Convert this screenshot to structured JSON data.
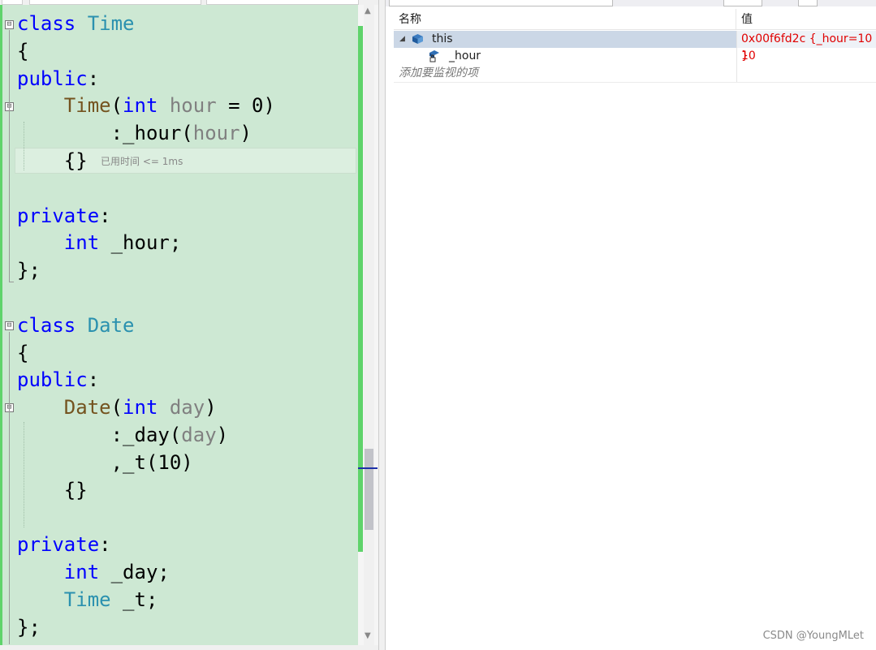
{
  "editor": {
    "lines": [
      [
        {
          "t": "class",
          "k": "kw"
        },
        {
          "t": " ",
          "k": "tx"
        },
        {
          "t": "Time",
          "k": "ty"
        }
      ],
      [
        {
          "t": "{",
          "k": "tx"
        }
      ],
      [
        {
          "t": "public",
          "k": "kw"
        },
        {
          "t": ":",
          "k": "tx"
        }
      ],
      [
        {
          "t": "    ",
          "k": "tx"
        },
        {
          "t": "Time",
          "k": "fn"
        },
        {
          "t": "(",
          "k": "tx"
        },
        {
          "t": "int",
          "k": "kw"
        },
        {
          "t": " ",
          "k": "tx"
        },
        {
          "t": "hour",
          "k": "pm"
        },
        {
          "t": " = 0)",
          "k": "tx"
        }
      ],
      [
        {
          "t": "        :_hour(",
          "k": "tx"
        },
        {
          "t": "hour",
          "k": "pm"
        },
        {
          "t": ")",
          "k": "tx"
        }
      ],
      [
        {
          "t": "    {}",
          "k": "tx"
        }
      ],
      [],
      [
        {
          "t": "private",
          "k": "kw"
        },
        {
          "t": ":",
          "k": "tx"
        }
      ],
      [
        {
          "t": "    ",
          "k": "tx"
        },
        {
          "t": "int",
          "k": "kw"
        },
        {
          "t": " _hour;",
          "k": "tx"
        }
      ],
      [
        {
          "t": "};",
          "k": "tx"
        }
      ],
      [],
      [
        {
          "t": "class",
          "k": "kw"
        },
        {
          "t": " ",
          "k": "tx"
        },
        {
          "t": "Date",
          "k": "ty"
        }
      ],
      [
        {
          "t": "{",
          "k": "tx"
        }
      ],
      [
        {
          "t": "public",
          "k": "kw"
        },
        {
          "t": ":",
          "k": "tx"
        }
      ],
      [
        {
          "t": "    ",
          "k": "tx"
        },
        {
          "t": "Date",
          "k": "fn"
        },
        {
          "t": "(",
          "k": "tx"
        },
        {
          "t": "int",
          "k": "kw"
        },
        {
          "t": " ",
          "k": "tx"
        },
        {
          "t": "day",
          "k": "pm"
        },
        {
          "t": ")",
          "k": "tx"
        }
      ],
      [
        {
          "t": "        :_day(",
          "k": "tx"
        },
        {
          "t": "day",
          "k": "pm"
        },
        {
          "t": ")",
          "k": "tx"
        }
      ],
      [
        {
          "t": "        ,_t(10)",
          "k": "tx"
        }
      ],
      [
        {
          "t": "    {}",
          "k": "tx"
        }
      ],
      [],
      [
        {
          "t": "private",
          "k": "kw"
        },
        {
          "t": ":",
          "k": "tx"
        }
      ],
      [
        {
          "t": "    ",
          "k": "tx"
        },
        {
          "t": "int",
          "k": "kw"
        },
        {
          "t": " _day;",
          "k": "tx"
        }
      ],
      [
        {
          "t": "    ",
          "k": "tx"
        },
        {
          "t": "Time",
          "k": "ty"
        },
        {
          "t": " _t;",
          "k": "tx"
        }
      ],
      [
        {
          "t": "};",
          "k": "tx"
        }
      ]
    ],
    "fold_markers": [
      "⊟",
      "⊟",
      "⊟",
      "⊟"
    ],
    "elapsed_hint": "已用时间 <= 1ms"
  },
  "watch": {
    "col_name": "名称",
    "col_value": "值",
    "rows": [
      {
        "name": "this",
        "value": "0x00f6fd2c {_hour=10 }",
        "expand": "◢"
      },
      {
        "name": "_hour",
        "value": "10"
      }
    ],
    "add_item": "添加要监视的项"
  },
  "watermark": "CSDN @YoungMLet"
}
